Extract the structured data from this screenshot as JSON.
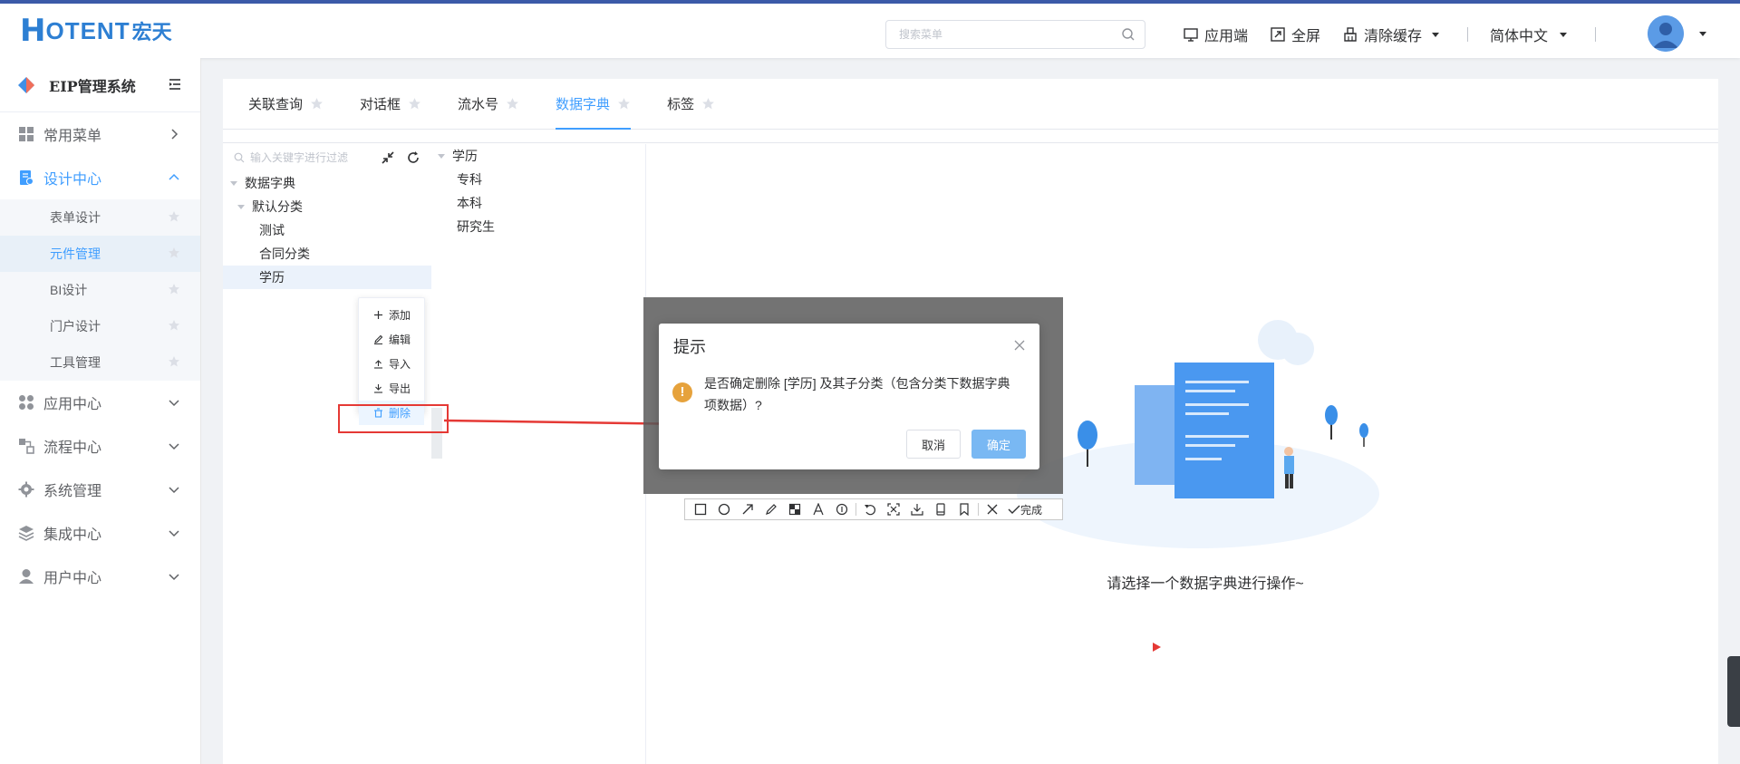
{
  "header": {
    "logo_h": "H",
    "logo_text": "OTENT",
    "logo_cn": "宏天",
    "search_placeholder": "搜索菜单",
    "items": [
      "应用端",
      "全屏",
      "清除缓存",
      "简体中文"
    ]
  },
  "sidebar": {
    "system_title": "EIP管理系统",
    "menus": [
      {
        "label": "常用菜单"
      },
      {
        "label": "设计中心"
      },
      {
        "label": "应用中心"
      },
      {
        "label": "流程中心"
      },
      {
        "label": "系统管理"
      },
      {
        "label": "集成中心"
      },
      {
        "label": "用户中心"
      }
    ],
    "design_sub": [
      "表单设计",
      "元件管理",
      "BI设计",
      "门户设计",
      "工具管理"
    ]
  },
  "tabs": [
    "关联查询",
    "对话框",
    "流水号",
    "数据字典",
    "标签"
  ],
  "active_tab": "数据字典",
  "tree": {
    "filter_placeholder": "输入关键字进行过滤",
    "nodes": [
      "数据字典",
      "默认分类",
      "测试",
      "合同分类",
      "学历"
    ]
  },
  "detail_tree": {
    "root": "学历",
    "children": [
      "专科",
      "本科",
      "研究生"
    ]
  },
  "context_menu": [
    "添加",
    "编辑",
    "导入",
    "导出",
    "删除"
  ],
  "dialog": {
    "title": "提示",
    "icon": "!",
    "message": "是否确定删除 [学历] 及其子分类（包含分类下数据字典项数据）?",
    "cancel": "取消",
    "confirm": "确定"
  },
  "annotation_toolbar": {
    "done": "完成"
  },
  "empty_state": {
    "text": "请选择一个数据字典进行操作~"
  },
  "colors": {
    "primary": "#409eff",
    "warning": "#e6a23c",
    "annotation_red": "#e53935"
  }
}
